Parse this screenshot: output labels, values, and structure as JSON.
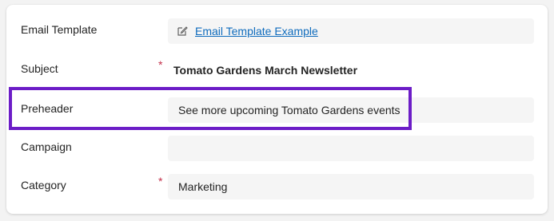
{
  "form": {
    "rows": [
      {
        "label": "Email Template",
        "required": false,
        "value": "Email Template Example",
        "type": "link",
        "icon": "edit-icon"
      },
      {
        "label": "Subject",
        "required": true,
        "value": "Tomato Gardens March Newsletter",
        "type": "readonly"
      },
      {
        "label": "Preheader",
        "required": false,
        "value": "See more upcoming Tomato Gardens events",
        "type": "text"
      },
      {
        "label": "Campaign",
        "required": false,
        "value": "",
        "type": "text"
      },
      {
        "label": "Category",
        "required": true,
        "value": "Marketing",
        "type": "text"
      }
    ],
    "required_marker": "*"
  },
  "colors": {
    "highlight": "#6c1dc7",
    "link": "#0f6cbd",
    "required": "#c4314b",
    "field_bg": "#f5f5f5"
  }
}
